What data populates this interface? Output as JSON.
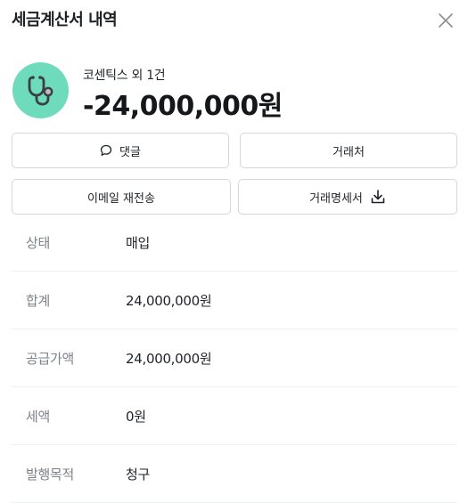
{
  "header": {
    "title": "세금계산서 내역",
    "close_icon": "close-icon"
  },
  "summary": {
    "avatar_icon": "stethoscope-icon",
    "avatar_color": "#6edbbd",
    "vendor": "코센틱스 외 1건",
    "amount": "-24,000,000원"
  },
  "actions": {
    "comment_label": "댓글",
    "comment_icon": "chat-bubble-icon",
    "partner_label": "거래처",
    "resend_label": "이메일 재전송",
    "statement_label": "거래명세서",
    "statement_icon": "download-icon"
  },
  "details": [
    {
      "label": "상태",
      "value": "매입"
    },
    {
      "label": "합계",
      "value": "24,000,000원"
    },
    {
      "label": "공급가액",
      "value": "24,000,000원"
    },
    {
      "label": "세액",
      "value": "0원"
    },
    {
      "label": "발행목적",
      "value": "청구"
    }
  ]
}
